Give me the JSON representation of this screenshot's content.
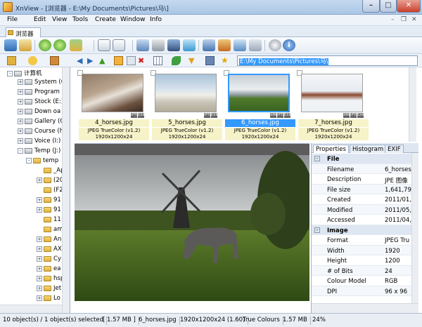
{
  "window": {
    "title": "XnView - [浏览器 - E:\\My Documents\\Pictures\\马\\]"
  },
  "menu": [
    "File",
    "Edit",
    "View",
    "Tools",
    "Create",
    "Window",
    "Info"
  ],
  "tab": {
    "label": "浏览器"
  },
  "address": "E:\\My Documents\\Pictures\\马\\",
  "tree": {
    "root": "计算机",
    "drives": [
      "System (C",
      "Program",
      "Stock (E:)",
      "Down oa",
      "Gallery (G",
      "Course (h",
      "Voice (I:)",
      "Temp (J:)"
    ],
    "temp_folder": "temp",
    "sub": [
      "_Ap",
      "(20",
      "(F2",
      "91",
      "91",
      "11:",
      "am",
      "An",
      "AX",
      "Cy",
      "ea",
      "hsp",
      "Jet",
      "Lo"
    ]
  },
  "thumbnails": [
    {
      "name": "4_horses.jpg",
      "format": "JPEG TrueColor (v1.2)",
      "dims": "1920x1200x24",
      "selected": false
    },
    {
      "name": "5_horses.jpg",
      "format": "JPEG TrueColor (v1.2)",
      "dims": "1920x1200x24",
      "selected": false
    },
    {
      "name": "6_horses.jpg",
      "format": "JPEG TrueColor (v1.2)",
      "dims": "1920x1200x24",
      "selected": true
    },
    {
      "name": "7_horses.jpg",
      "format": "JPEG TrueColor (v1.2)",
      "dims": "1920x1200x24",
      "selected": false
    }
  ],
  "badges": {
    "exif": "EXIF",
    "iptc": "IPTC",
    "xmp": "XMP"
  },
  "properties": {
    "tabs": [
      "Properties",
      "Histogram",
      "EXIF"
    ],
    "rows": [
      {
        "key": "File",
        "value": "",
        "group": true
      },
      {
        "key": "Filename",
        "value": "6_horses",
        "group": false
      },
      {
        "key": "Description",
        "value": "JPE 图像",
        "group": false
      },
      {
        "key": "File size",
        "value": "1,641,79",
        "group": false
      },
      {
        "key": "Created",
        "value": "2011/01,",
        "group": false
      },
      {
        "key": "Modified",
        "value": "2011/05,",
        "group": false
      },
      {
        "key": "Accessed",
        "value": "2011/04,",
        "group": false
      },
      {
        "key": "Image",
        "value": "",
        "group": true
      },
      {
        "key": "Format",
        "value": "JPEG Tru",
        "group": false
      },
      {
        "key": "Width",
        "value": "1920",
        "group": false
      },
      {
        "key": "Height",
        "value": "1200",
        "group": false
      },
      {
        "key": "# of Bits",
        "value": "24",
        "group": false
      },
      {
        "key": "Colour Model",
        "value": "RGB",
        "group": false
      },
      {
        "key": "DPI",
        "value": "96 x 96",
        "group": false
      }
    ]
  },
  "status": [
    "10 object(s) / 1 object(s) selected",
    "[ 1.57 MB ]",
    "6_horses.jpg",
    "1920x1200x24 (1.60)",
    "True Colours",
    "1.57 MB",
    "24%"
  ],
  "colors": {
    "accent": "#3399ff",
    "window": "#aac6e6"
  }
}
